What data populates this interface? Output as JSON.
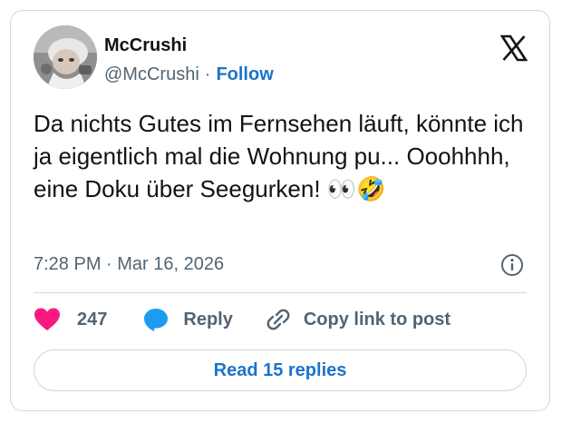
{
  "author": {
    "display_name": "McCrushi",
    "handle": "@McCrushi",
    "separator": "·",
    "follow_label": "Follow"
  },
  "tweet": {
    "text": "Da nichts Gutes im Fernsehen läuft, könnte ich ja eigentlich mal die Wohnung pu... Ooohhhh, eine Doku über Seegurken! ",
    "emojis": "👀🤣",
    "timestamp": "7:28 PM · Mar 16, 2026"
  },
  "actions": {
    "like_count": "247",
    "reply_label": "Reply",
    "copy_link_label": "Copy link to post"
  },
  "read_replies_label": "Read 15 replies",
  "icons": {
    "logo": "x-logo-icon",
    "info": "info-icon",
    "like": "heart-icon",
    "reply": "speech-bubble-icon",
    "copy": "link-icon"
  },
  "colors": {
    "link_blue": "#1d73c9",
    "like_pink": "#f91880",
    "reply_blue": "#1d9bf0",
    "muted_text": "#536471",
    "border": "#cfd9de"
  }
}
